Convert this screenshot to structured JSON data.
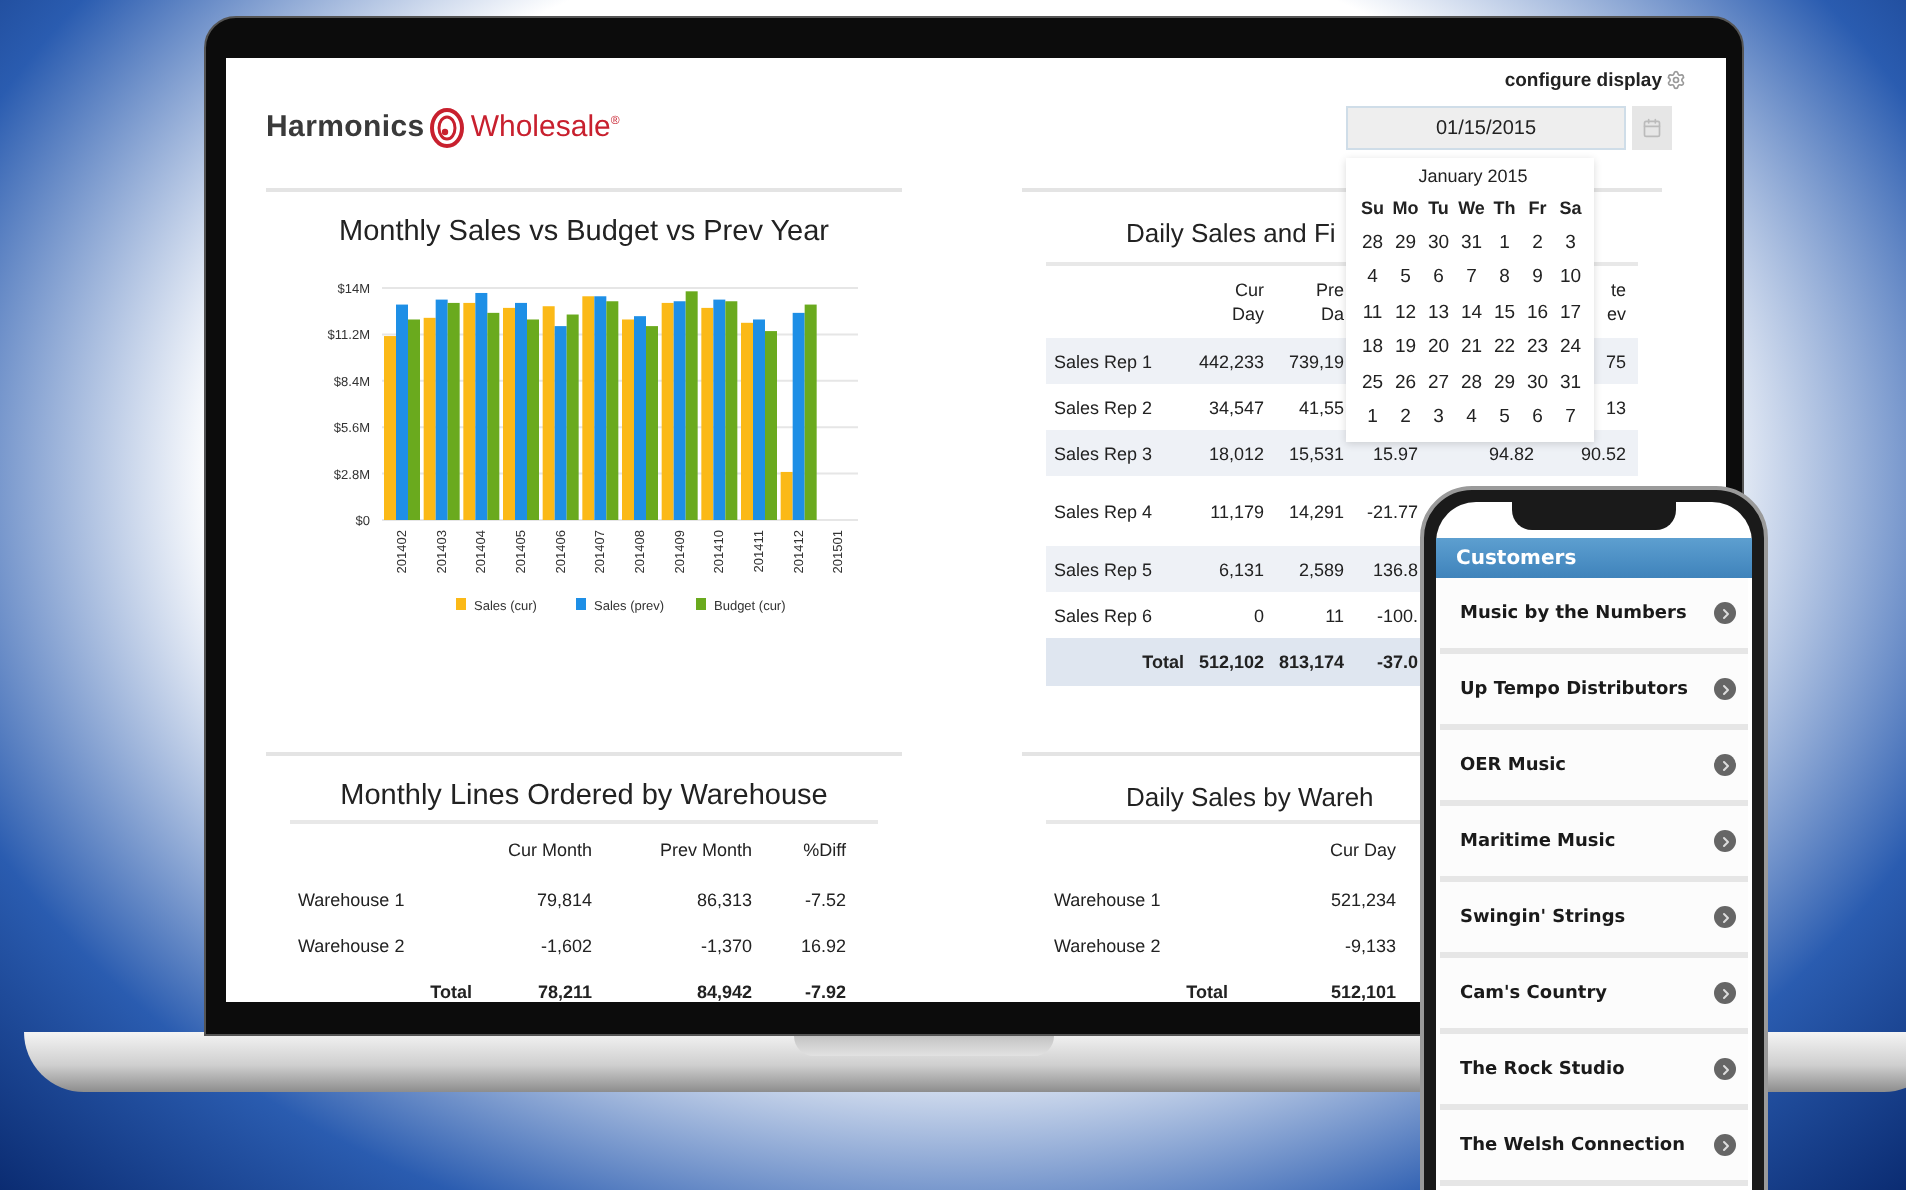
{
  "screen": {
    "logo": {
      "brand": "Harmonics",
      "product": "Wholesale$^{®}$"
    },
    "configure_display": "configure display",
    "date_field": {
      "value": "01/15/2015"
    },
    "calendar": {
      "title": "January 2015",
      "weekdays": [
        "Su",
        "Mo",
        "Tu",
        "We",
        "Th",
        "Fr",
        "Sa"
      ],
      "weeks": [
        [
          "28",
          "29",
          "30",
          "31",
          "1",
          "2",
          "3"
        ],
        [
          "4",
          "5",
          "6",
          "7",
          "8",
          "9",
          "10"
        ],
        [
          "11",
          "12",
          "13",
          "14",
          "15",
          "16",
          "17"
        ],
        [
          "18",
          "19",
          "20",
          "21",
          "22",
          "23",
          "24"
        ],
        [
          "25",
          "26",
          "27",
          "28",
          "29",
          "30",
          "31"
        ],
        [
          "1",
          "2",
          "3",
          "4",
          "5",
          "6",
          "7"
        ]
      ]
    },
    "monthly_sales": {
      "title": "Monthly Sales vs Budget vs Prev Year",
      "chart_data": {
        "type": "bar",
        "categories": [
          "201402",
          "201403",
          "201404",
          "201405",
          "201406",
          "201407",
          "201408",
          "201409",
          "201410",
          "201411",
          "201412",
          "201501"
        ],
        "series": [
          {
            "name": "Sales (cur)",
            "color": "#fbb917",
            "values": [
              11.1,
              12.2,
              13.1,
              12.8,
              12.9,
              13.5,
              12.1,
              13.1,
              12.8,
              11.9,
              2.9,
              null
            ]
          },
          {
            "name": "Sales (prev)",
            "color": "#1e8fe6",
            "values": [
              13.0,
              13.3,
              13.7,
              13.1,
              11.7,
              13.5,
              12.3,
              13.2,
              13.3,
              12.1,
              12.5,
              null
            ]
          },
          {
            "name": "Budget (cur)",
            "color": "#6aaa1e",
            "values": [
              12.1,
              13.1,
              12.5,
              12.1,
              12.4,
              13.2,
              11.7,
              13.8,
              13.2,
              11.4,
              13.0,
              null
            ]
          }
        ],
        "grid": true,
        "legend": "bottom",
        "ylim": [
          0,
          14
        ],
        "yticks": [
          {
            "value": 0,
            "label": "$0"
          },
          {
            "value": 2.8,
            "label": "$2.8M"
          },
          {
            "value": 5.6,
            "label": "$5.6M"
          },
          {
            "value": 8.4,
            "label": "$8.4M"
          },
          {
            "value": 11.2,
            "label": "$11.2M"
          },
          {
            "value": 14,
            "label": "$14M"
          }
        ]
      }
    },
    "daily_sales": {
      "title": "Daily Sales and Fi",
      "columns": {
        "cur_day": "Cur Day",
        "prev_day": "Pre\nDa",
        "column_6": "te\nev"
      },
      "rows": [
        {
          "name": "Sales Rep 1",
          "cur_day": "442,233",
          "prev_day": "739,19",
          "column_6": "75"
        },
        {
          "name": "Sales Rep 2",
          "cur_day": "34,547",
          "prev_day": "41,55",
          "column_6": "13"
        },
        {
          "name": "Sales Rep 3",
          "cur_day": "18,012",
          "prev_day": "15,531",
          "column_4": "15.97",
          "column_5": "94.82",
          "column_6": "90.52"
        },
        {
          "name": "Sales Rep 4",
          "cur_day": "11,179",
          "prev_day": "14,291",
          "column_4": "-21.77"
        },
        {
          "name": "Sales Rep 5",
          "cur_day": "6,131",
          "prev_day": "2,589",
          "column_4": "136.8"
        },
        {
          "name": "Sales Rep 6",
          "cur_day": "0",
          "prev_day": "11",
          "column_4": "-100."
        }
      ],
      "total": {
        "label": "Total",
        "cur_day": "512,102",
        "prev_day": "813,174",
        "column_4": "-37.0"
      }
    },
    "monthly_lines": {
      "title": "Monthly Lines Ordered by Warehouse",
      "columns": [
        "Cur Month",
        "Prev Month",
        "%Diff"
      ],
      "rows": [
        {
          "name": "Warehouse 1",
          "values": [
            "79,814",
            "86,313",
            "-7.52"
          ]
        },
        {
          "name": "Warehouse 2",
          "values": [
            "-1,602",
            "-1,370",
            "16.92"
          ]
        }
      ],
      "total": {
        "label": "Total",
        "values": [
          "78,211",
          "84,942",
          "-7.92"
        ]
      }
    },
    "daily_sales_by_warehouse": {
      "title": "Daily Sales by Wareh",
      "columns": [
        "Cur Day"
      ],
      "rows": [
        {
          "name": "Warehouse 1",
          "values": [
            "521,234"
          ]
        },
        {
          "name": "Warehouse 2",
          "values": [
            "-9,133"
          ]
        }
      ],
      "total": {
        "label": "Total",
        "values": [
          "512,101"
        ]
      }
    }
  },
  "phone": {
    "header": "Customers",
    "customers": [
      "Music by the Numbers",
      "Up Tempo Distributors",
      "OER Music",
      "Maritime Music",
      "Swingin' Strings",
      "Cam's Country",
      "The Rock Studio",
      "The Welsh Connection"
    ]
  }
}
